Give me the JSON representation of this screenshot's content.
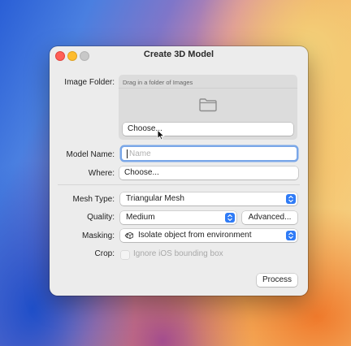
{
  "dialog": {
    "title": "Create 3D Model",
    "image_folder": {
      "label": "Image Folder:",
      "drop_hint": "Drag in a folder of Images",
      "choose_button": "Choose..."
    },
    "model_name": {
      "label": "Model Name:",
      "value": "",
      "placeholder": "Name"
    },
    "where": {
      "label": "Where:",
      "choose_button": "Choose..."
    },
    "mesh_type": {
      "label": "Mesh Type:",
      "selected": "Triangular Mesh"
    },
    "quality": {
      "label": "Quality:",
      "selected": "Medium",
      "advanced_button": "Advanced..."
    },
    "masking": {
      "label": "Masking:",
      "selected": "Isolate object from environment"
    },
    "crop": {
      "label": "Crop:",
      "checkbox_label": "Ignore iOS bounding box",
      "checked": false,
      "enabled": false
    },
    "process_button": "Process"
  },
  "colors": {
    "accent": "#2f7bf6",
    "close": "#ff5f57",
    "minimize": "#febc2e",
    "zoom_inactive": "#c8c8c8"
  },
  "icons": [
    "close-icon",
    "minimize-icon",
    "zoom-icon",
    "folder-icon",
    "pointer-cursor-icon",
    "stepper-arrows-icon",
    "cube-icon"
  ]
}
